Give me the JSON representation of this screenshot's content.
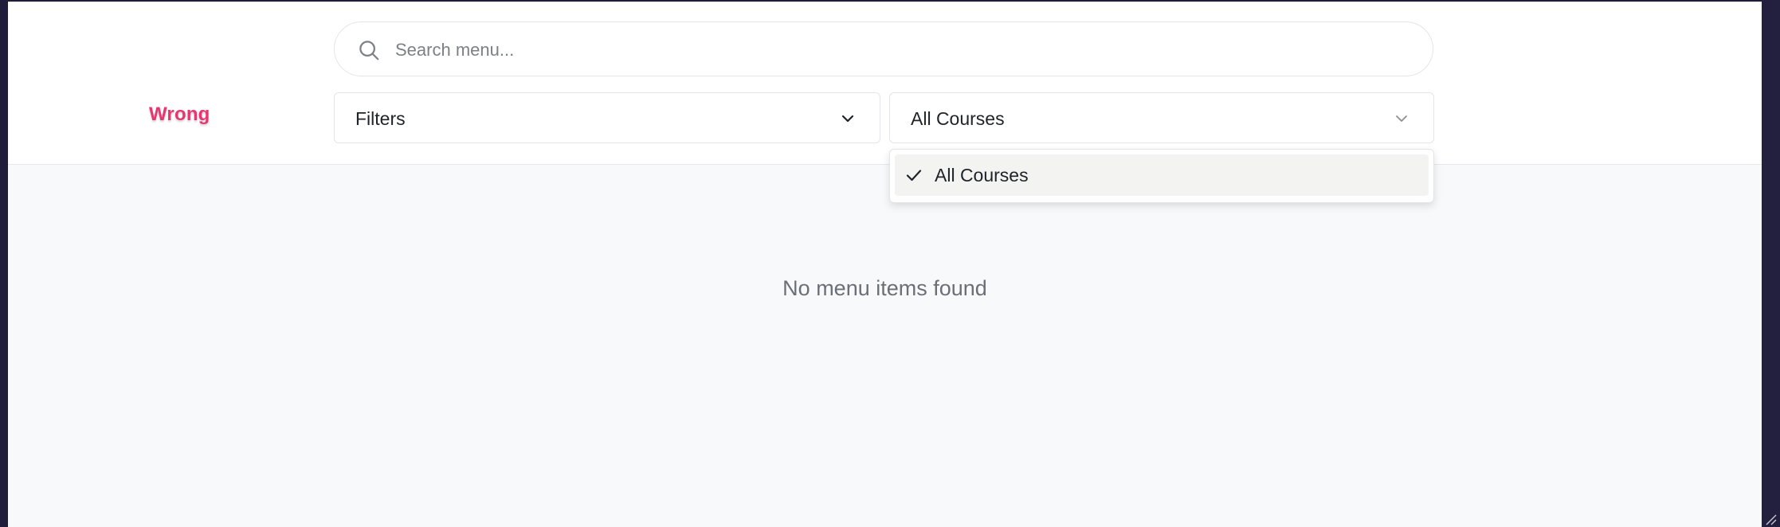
{
  "brand": {
    "label": "Wrong",
    "color": "#e8366e"
  },
  "search": {
    "placeholder": "Search menu...",
    "value": "",
    "icon": "search-icon"
  },
  "filters": {
    "label": "Filters",
    "icon": "chevron-down-icon"
  },
  "courses": {
    "selected": "All Courses",
    "icon": "chevron-down-icon",
    "options": [
      {
        "label": "All Courses",
        "selected": true,
        "icon": "check-icon"
      }
    ]
  },
  "empty_state": {
    "message": "No menu items found"
  },
  "colors": {
    "frame": "#231f3f",
    "header_bg": "#ffffff",
    "content_bg": "#f8f9fb",
    "hover_bg": "#f3f3f2"
  }
}
